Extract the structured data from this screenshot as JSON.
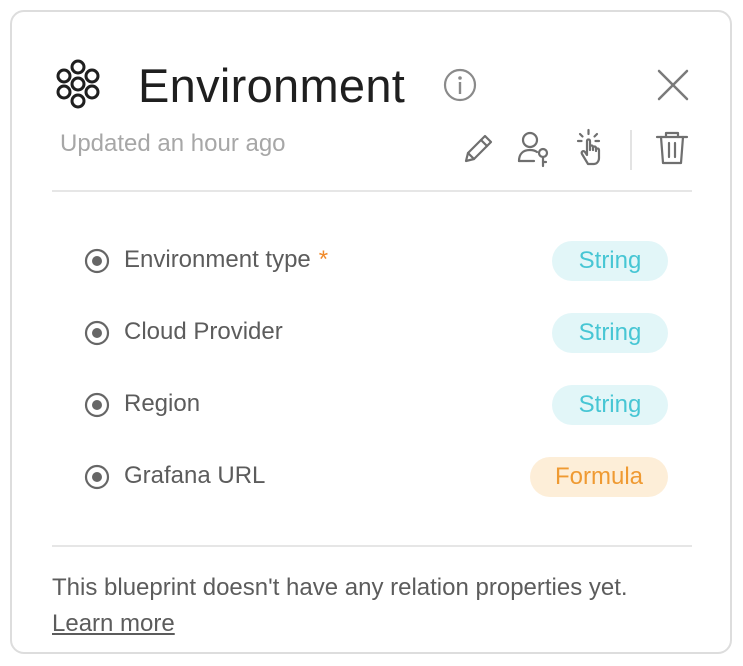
{
  "header": {
    "title": "Environment",
    "updated": "Updated an hour ago",
    "icons": {
      "blueprint": "blueprint-icon",
      "info": "info-icon",
      "close": "close-icon"
    }
  },
  "actions": [
    {
      "name": "edit",
      "icon": "pencil-icon"
    },
    {
      "name": "permissions",
      "icon": "user-key-icon"
    },
    {
      "name": "actions",
      "icon": "pointer-click-icon"
    },
    {
      "name": "delete",
      "icon": "trash-icon"
    }
  ],
  "properties": [
    {
      "name": "Environment type",
      "required": "*",
      "type": "String"
    },
    {
      "name": "Cloud Provider",
      "type": "String"
    },
    {
      "name": "Region",
      "type": "String"
    },
    {
      "name": "Grafana URL",
      "type": "Formula"
    }
  ],
  "footer": {
    "text": "This blueprint doesn't have any relation properties yet.",
    "link": "Learn more"
  },
  "colors": {
    "string_bg": "#e2f6f8",
    "string_fg": "#47c6d4",
    "formula_bg": "#fdeed8",
    "formula_fg": "#ef9a32",
    "required": "#f08a2b"
  }
}
